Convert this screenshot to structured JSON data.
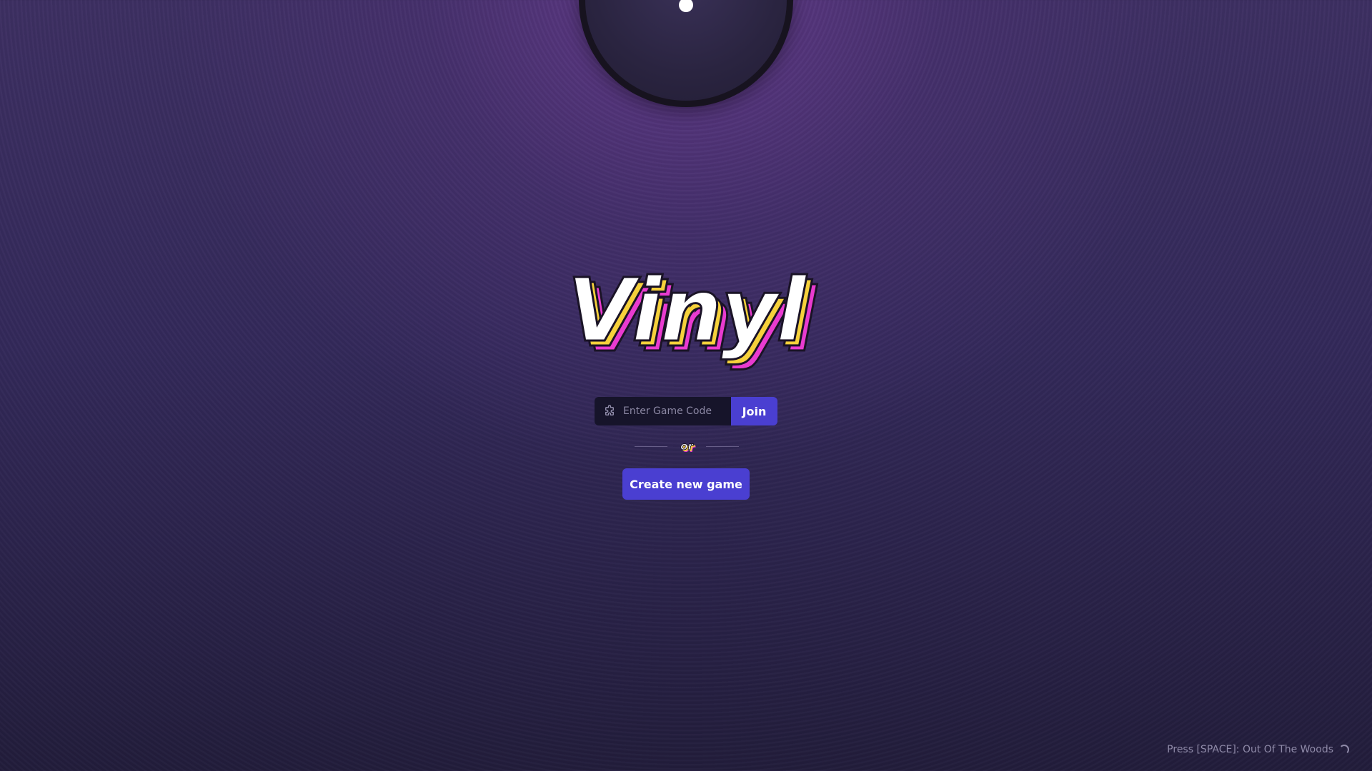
{
  "logo": {
    "text": "Vinyl"
  },
  "join": {
    "placeholder": "Enter Game Code",
    "icon": "puzzle-icon",
    "button_label": "Join"
  },
  "divider": {
    "label": "or"
  },
  "create": {
    "button_label": "Create new game"
  },
  "footer": {
    "now_playing": "Press [SPACE]: Out Of The Woods",
    "icon": "loading-spinner-icon"
  },
  "colors": {
    "accent": "#4a3fd1",
    "logo_pink": "#e93bd0",
    "logo_yellow": "#f6d13b",
    "input_bg": "#16142a"
  }
}
